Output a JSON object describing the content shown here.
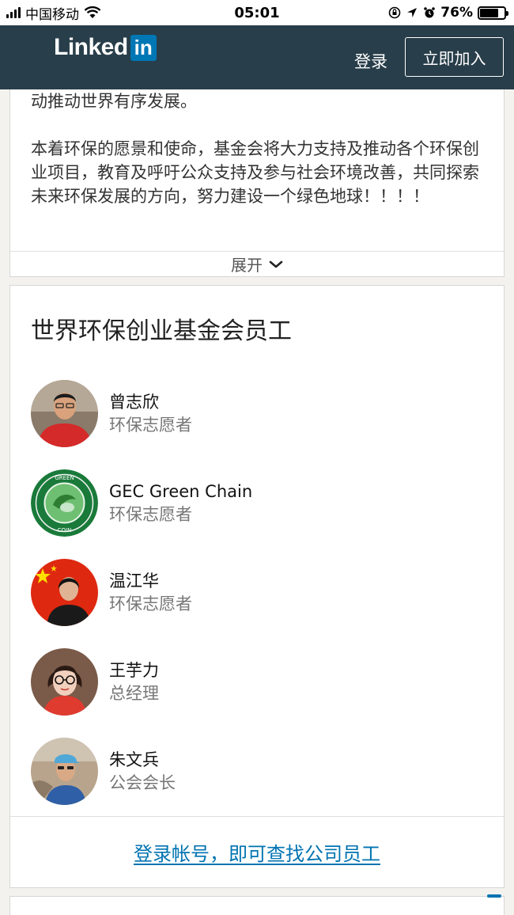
{
  "status_bar": {
    "carrier": "中国移动",
    "time": "05:01",
    "battery_percent": "76%",
    "battery_level": 0.76
  },
  "header": {
    "logo_text": "Linked",
    "logo_badge": "in",
    "signin_label": "登录",
    "join_label": "立即加入"
  },
  "about": {
    "paragraph_1_tail": "动推动世界有序发展。",
    "paragraph_2": "本着环保的愿景和使命，基金会将大力支持及推动各个环保创业项目，教育及呼吁公众支持及参与社会环境改善，共同探索未来环保发展的方向，努力建设一个绿色地球！！！！",
    "expand_label": "展开"
  },
  "employees": {
    "title": "世界环保创业基金会员工",
    "items": [
      {
        "name": "曾志欣",
        "role": "环保志愿者",
        "avatar": "person-red-shirt"
      },
      {
        "name": "GEC Green Chain",
        "role": "环保志愿者",
        "avatar": "green-coin-logo"
      },
      {
        "name": "温江华",
        "role": "环保志愿者",
        "avatar": "person-china-flag"
      },
      {
        "name": "王芋力",
        "role": "总经理",
        "avatar": "person-glasses"
      },
      {
        "name": "朱文兵",
        "role": "公会会长",
        "avatar": "person-cap-outdoor"
      }
    ],
    "footer_link": "登录帐号，即可查找公司员工"
  },
  "colors": {
    "nav_bg": "#283e4a",
    "brand_blue": "#0077b5",
    "link_blue": "#0073b1"
  }
}
